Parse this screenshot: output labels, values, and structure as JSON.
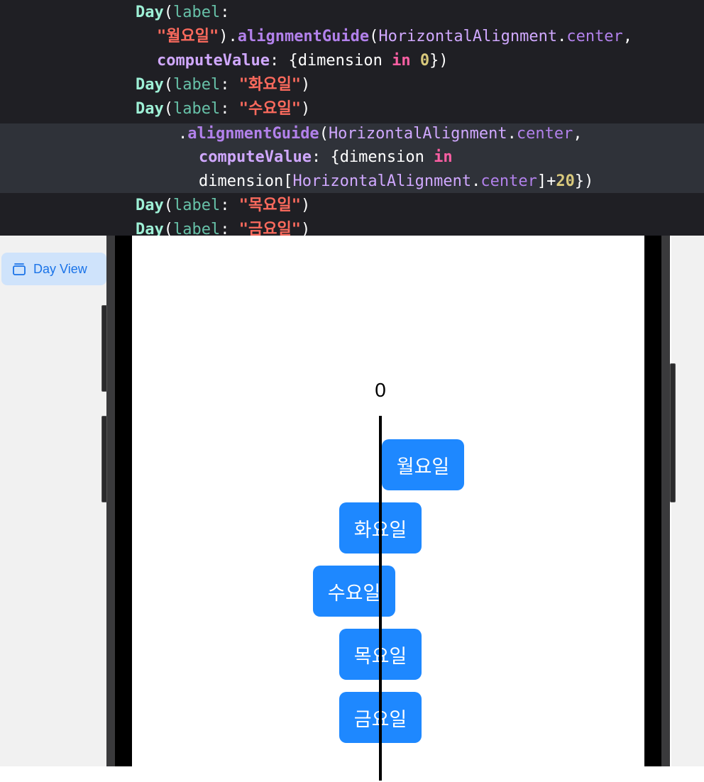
{
  "code": {
    "lines": [
      [
        [
          "Day",
          "type"
        ],
        [
          "(",
          "plain"
        ],
        [
          "label",
          "param"
        ],
        [
          ":",
          "plain"
        ]
      ],
      [
        [
          "\"월요일\"",
          "str"
        ],
        [
          ").",
          "plain"
        ],
        [
          "alignmentGuide",
          "meth"
        ],
        [
          "(",
          "plain"
        ],
        [
          "HorizontalAlignment",
          "cls"
        ],
        [
          ".",
          "plain"
        ],
        [
          "center",
          "prop"
        ],
        [
          ",",
          "plain"
        ]
      ],
      [
        [
          "computeValue",
          "arg"
        ],
        [
          ": {dimension ",
          "plain"
        ],
        [
          "in",
          "kw"
        ],
        [
          " ",
          "plain"
        ],
        [
          "0",
          "num"
        ],
        [
          "})",
          "plain"
        ]
      ],
      [
        [
          "Day",
          "type"
        ],
        [
          "(",
          "plain"
        ],
        [
          "label",
          "param"
        ],
        [
          ": ",
          "plain"
        ],
        [
          "\"화요일\"",
          "str"
        ],
        [
          ")",
          "plain"
        ]
      ],
      [
        [
          "Day",
          "type"
        ],
        [
          "(",
          "plain"
        ],
        [
          "label",
          "param"
        ],
        [
          ": ",
          "plain"
        ],
        [
          "\"수요일\"",
          "str"
        ],
        [
          ")",
          "plain"
        ]
      ],
      [
        [
          ".",
          "plain"
        ],
        [
          "alignmentGuide",
          "meth"
        ],
        [
          "(",
          "plain"
        ],
        [
          "HorizontalAlignment",
          "cls"
        ],
        [
          ".",
          "plain"
        ],
        [
          "center",
          "prop"
        ],
        [
          ",",
          "plain"
        ]
      ],
      [
        [
          "computeValue",
          "arg"
        ],
        [
          ": {dimension ",
          "plain"
        ],
        [
          "in",
          "kw"
        ]
      ],
      [
        [
          "dimension[",
          "plain"
        ],
        [
          "HorizontalAlignment",
          "cls"
        ],
        [
          ".",
          "plain"
        ],
        [
          "center",
          "prop"
        ],
        [
          "]+",
          "plain"
        ],
        [
          "20",
          "num"
        ],
        [
          "})",
          "plain"
        ]
      ],
      [
        [
          "Day",
          "type"
        ],
        [
          "(",
          "plain"
        ],
        [
          "label",
          "param"
        ],
        [
          ": ",
          "plain"
        ],
        [
          "\"목요일\"",
          "str"
        ],
        [
          ")",
          "plain"
        ]
      ],
      [
        [
          "Day",
          "type"
        ],
        [
          "(",
          "plain"
        ],
        [
          "label",
          "param"
        ],
        [
          ": ",
          "plain"
        ],
        [
          "\"금요일\"",
          "str"
        ],
        [
          ")",
          "plain"
        ]
      ]
    ]
  },
  "preview": {
    "tab_label": "Day View",
    "guide_label": "0",
    "days": [
      "월요일",
      "화요일",
      "수요일",
      "목요일",
      "금요일"
    ]
  }
}
